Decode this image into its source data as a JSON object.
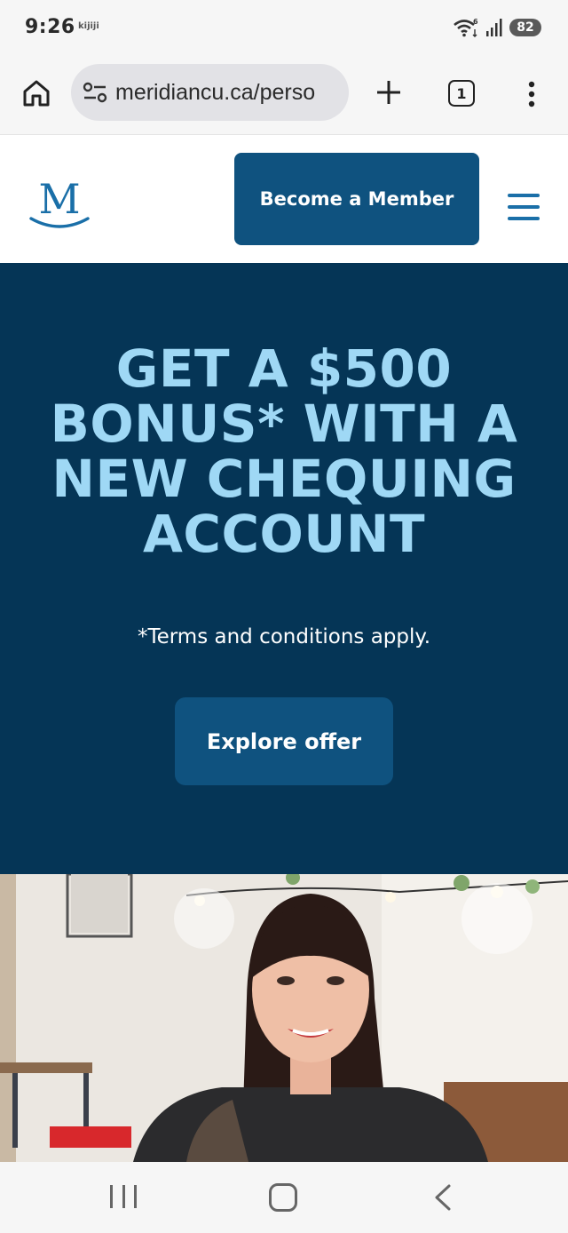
{
  "status_bar": {
    "time": "9:26",
    "app_indicator": "kijiji",
    "wifi_badge": "6",
    "battery": "82"
  },
  "browser": {
    "url": "meridiancu.ca/perso",
    "tab_count": "1",
    "icons": [
      "home-icon",
      "tune-icon",
      "plus-icon",
      "tabs-icon",
      "more-vert-icon"
    ]
  },
  "header": {
    "logo_letter": "M",
    "become_member_label": "Become a Member"
  },
  "hero": {
    "title_line1": "GET A $500",
    "title_line2": "BONUS* WITH A",
    "title_line3": "NEW CHEQUING",
    "title_line4": "ACCOUNT",
    "terms": "*Terms and conditions apply.",
    "cta_label": "Explore offer"
  },
  "colors": {
    "brand_navy": "#053556",
    "button_blue": "#0f527f",
    "hero_title": "#9fd8f5",
    "logo_blue": "#1a6fa8"
  },
  "nav": {
    "icons": [
      "recent-apps-icon",
      "home-nav-icon",
      "back-icon"
    ]
  }
}
